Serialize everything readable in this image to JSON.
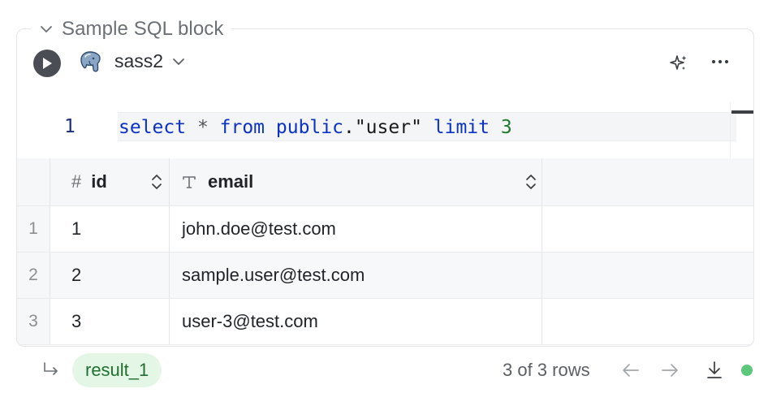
{
  "block": {
    "title": "Sample SQL block",
    "database": "sass2"
  },
  "editor": {
    "line_number": "1",
    "code": [
      {
        "t": "kw",
        "v": "select"
      },
      {
        "t": "op",
        "v": " * "
      },
      {
        "t": "kw",
        "v": "from"
      },
      {
        "t": "op",
        "v": " "
      },
      {
        "t": "kw",
        "v": "public"
      },
      {
        "t": "str",
        "v": ".\"user\" "
      },
      {
        "t": "kw",
        "v": "limit"
      },
      {
        "t": "op",
        "v": " "
      },
      {
        "t": "num",
        "v": "3"
      }
    ]
  },
  "table": {
    "columns": [
      {
        "name": "id",
        "type_icon": "#"
      },
      {
        "name": "email",
        "type_icon": "T"
      }
    ],
    "rows": [
      {
        "index": "1",
        "id": "1",
        "email": "john.doe@test.com"
      },
      {
        "index": "2",
        "id": "2",
        "email": "sample.user@test.com"
      },
      {
        "index": "3",
        "id": "3",
        "email": "user-3@test.com"
      }
    ]
  },
  "footer": {
    "result_name": "result_1",
    "rows_text": "3 of 3 rows"
  },
  "colors": {
    "accent_green": "#5cc97a",
    "pill_bg": "#e4f6e6",
    "keyword_blue": "#0a32c8",
    "number_green": "#1f7a2e"
  },
  "icons": {
    "run": "play-icon",
    "database": "postgresql-elephant-icon",
    "ai": "sparkles-icon",
    "more": "ellipsis-icon",
    "return": "return-arrow-icon",
    "prev": "arrow-left-icon",
    "next": "arrow-right-icon",
    "download": "download-icon"
  }
}
